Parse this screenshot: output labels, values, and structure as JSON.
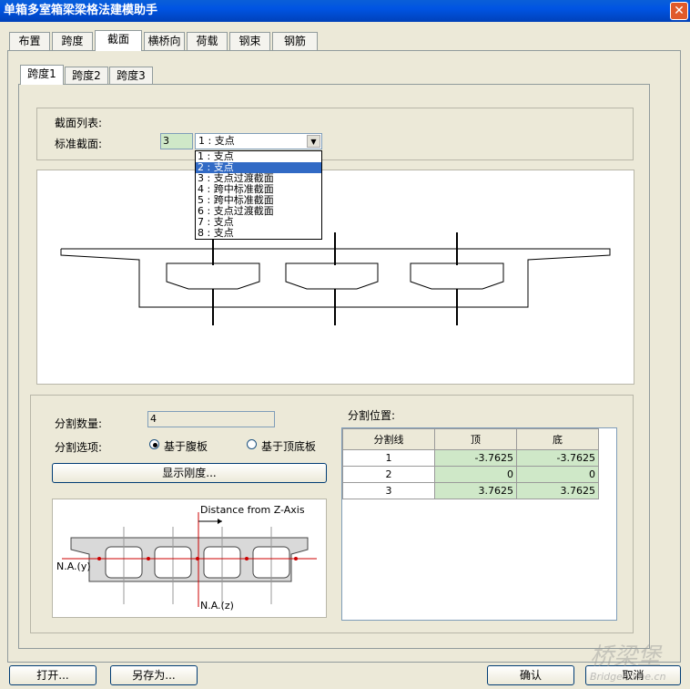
{
  "window": {
    "title": "单箱多室箱梁梁格法建模助手",
    "close": "✕"
  },
  "tabs": [
    {
      "label": "布置"
    },
    {
      "label": "跨度"
    },
    {
      "label": "截面"
    },
    {
      "label": "横桥向"
    },
    {
      "label": "荷载"
    },
    {
      "label": "钢束"
    },
    {
      "label": "钢筋"
    }
  ],
  "subtabs": [
    {
      "label": "跨度1"
    },
    {
      "label": "跨度2"
    },
    {
      "label": "跨度3"
    }
  ],
  "section_list": {
    "title": "截面列表:",
    "std_label": "标准截面:",
    "std_value": "3",
    "combo_value": "1 : 支点",
    "items": [
      "1 : 支点",
      "2 : 支点",
      "3 : 支点过渡截面",
      "4 : 跨中标准截面",
      "5 : 跨中标准截面",
      "6 : 支点过渡截面",
      "7 : 支点",
      "8 : 支点"
    ]
  },
  "split": {
    "count_label": "分割数量:",
    "count_value": "4",
    "option_label": "分割选项:",
    "opt_web": "基于腹板",
    "opt_bottom": "基于顶底板",
    "stiffness_button": "显示刚度...",
    "position_label": "分割位置:",
    "table": {
      "headers": [
        "分割线",
        "顶",
        "底"
      ],
      "rows": [
        [
          "1",
          "-3.7625",
          "-3.7625"
        ],
        [
          "2",
          "0",
          "0"
        ],
        [
          "3",
          "3.7625",
          "3.7625"
        ]
      ]
    }
  },
  "diagram": {
    "distance_label": "Distance from Z-Axis",
    "na_y": "N.A.(y)",
    "na_z": "N.A.(z)"
  },
  "buttons": {
    "open": "打开...",
    "save_as": "另存为...",
    "ok": "确认",
    "cancel": "取消"
  },
  "watermark": {
    "text1": "桥梁堡",
    "text2": "Bridgehome.cn"
  },
  "colors": {
    "title_bar": "#0054e3",
    "field_green": "#cfe8c8",
    "selection": "#316ac5"
  }
}
